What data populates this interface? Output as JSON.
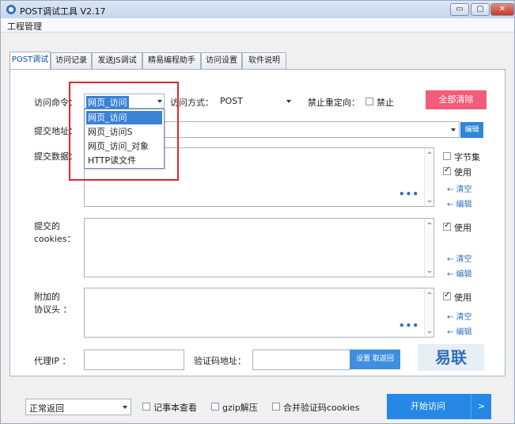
{
  "window": {
    "title": "POST调试工具 V2.17",
    "min": "▭",
    "max": "▢",
    "close": "✕"
  },
  "menu": {
    "project": "工程管理"
  },
  "tabs": [
    "POST调试",
    "访问记录",
    "发送JS调试",
    "精易编程助手",
    "访问设置",
    "软件说明"
  ],
  "form": {
    "command_label": "访问命令：",
    "command_value": "网页_访问",
    "method_label": "访问方式：",
    "method_value": "POST",
    "redirect_label": "禁止重定向：",
    "redirect_check": "禁止",
    "clear_all": "全部清除",
    "url_label": "提交地址：",
    "edit_button": "编辑",
    "data_label": "提交数据：",
    "byteset": "字节集",
    "use": "使用",
    "clear": "← 清空",
    "edit": "← 编辑",
    "cookies_label_1": "提交的",
    "cookies_label_2": "cookies：",
    "headers_label_1": "附加的",
    "headers_label_2": "协议头 ：",
    "dots": "•••",
    "proxy_label": "代理IP ：",
    "captcha_label": "验证码地址：",
    "captcha_buttons": "设置  取返回",
    "logo": "易联"
  },
  "dropdown": {
    "items": [
      "网页_访问",
      "网页_访问S",
      "网页_访问_对象",
      "HTTP读文件"
    ],
    "selected": 0
  },
  "bottom": {
    "return_value": "正常返回",
    "notepad": "记事本查看",
    "gzip": "gzip解压",
    "merge": "合并验证码cookies",
    "start": "开始访问",
    "start_arrow": ">"
  },
  "colors": {
    "accent": "#2588e5",
    "clear_all": "#f55b7a",
    "highlight": "#e0272a"
  }
}
